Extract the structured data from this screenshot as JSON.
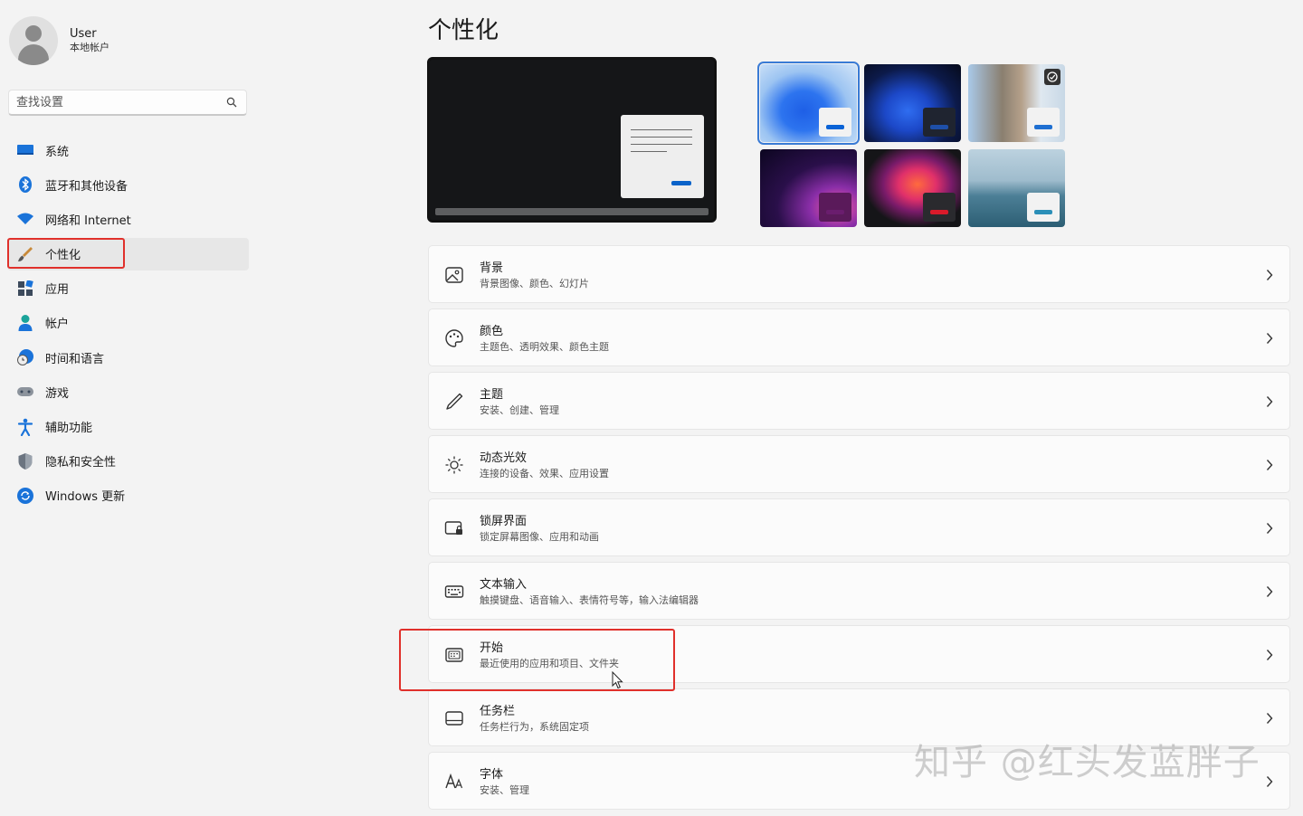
{
  "user": {
    "name": "User",
    "account_type": "本地帐户"
  },
  "search": {
    "placeholder": "查找设置",
    "value": ""
  },
  "nav": {
    "items": [
      {
        "label": "系统",
        "icon": "monitor-icon",
        "selected": false
      },
      {
        "label": "蓝牙和其他设备",
        "icon": "bluetooth-icon",
        "selected": false
      },
      {
        "label": "网络和 Internet",
        "icon": "wifi-icon",
        "selected": false
      },
      {
        "label": "个性化",
        "icon": "brush-icon",
        "selected": true
      },
      {
        "label": "应用",
        "icon": "apps-icon",
        "selected": false
      },
      {
        "label": "帐户",
        "icon": "person-icon",
        "selected": false
      },
      {
        "label": "时间和语言",
        "icon": "globe-clock-icon",
        "selected": false
      },
      {
        "label": "游戏",
        "icon": "gamepad-icon",
        "selected": false
      },
      {
        "label": "辅助功能",
        "icon": "accessibility-icon",
        "selected": false
      },
      {
        "label": "隐私和安全性",
        "icon": "shield-icon",
        "selected": false
      },
      {
        "label": "Windows 更新",
        "icon": "refresh-icon",
        "selected": false
      }
    ]
  },
  "page": {
    "title": "个性化"
  },
  "themes": [
    {
      "name": "theme-windows-light",
      "selected": true,
      "accent": "#0a63d6"
    },
    {
      "name": "theme-windows-dark",
      "selected": false,
      "accent": "#1e4fa8"
    },
    {
      "name": "theme-flower",
      "selected": false,
      "accent": "#1f6fd1"
    },
    {
      "name": "theme-glow",
      "selected": false,
      "accent": "#6a1d6e"
    },
    {
      "name": "theme-captured-motion",
      "selected": false,
      "accent": "#d91a2a"
    },
    {
      "name": "theme-sunrise",
      "selected": false,
      "accent": "#2b8fb8"
    }
  ],
  "settings": [
    {
      "title": "背景",
      "subtitle": "背景图像、颜色、幻灯片",
      "icon": "image-icon"
    },
    {
      "title": "颜色",
      "subtitle": "主题色、透明效果、颜色主题",
      "icon": "palette-icon"
    },
    {
      "title": "主题",
      "subtitle": "安装、创建、管理",
      "icon": "pen-icon"
    },
    {
      "title": "动态光效",
      "subtitle": "连接的设备、效果、应用设置",
      "icon": "lighting-icon"
    },
    {
      "title": "锁屏界面",
      "subtitle": "锁定屏幕图像、应用和动画",
      "icon": "lock-screen-icon"
    },
    {
      "title": "文本输入",
      "subtitle": "触摸键盘、语音输入、表情符号等，输入法编辑器",
      "icon": "keyboard-icon"
    },
    {
      "title": "开始",
      "subtitle": "最近使用的应用和项目、文件夹",
      "icon": "start-menu-icon"
    },
    {
      "title": "任务栏",
      "subtitle": "任务栏行为，系统固定项",
      "icon": "taskbar-icon"
    },
    {
      "title": "字体",
      "subtitle": "安装、管理",
      "icon": "font-icon"
    }
  ],
  "watermark": "知乎 @红头发蓝胖子",
  "colors": {
    "highlight": "#e0302b",
    "accent": "#0b63c9"
  }
}
